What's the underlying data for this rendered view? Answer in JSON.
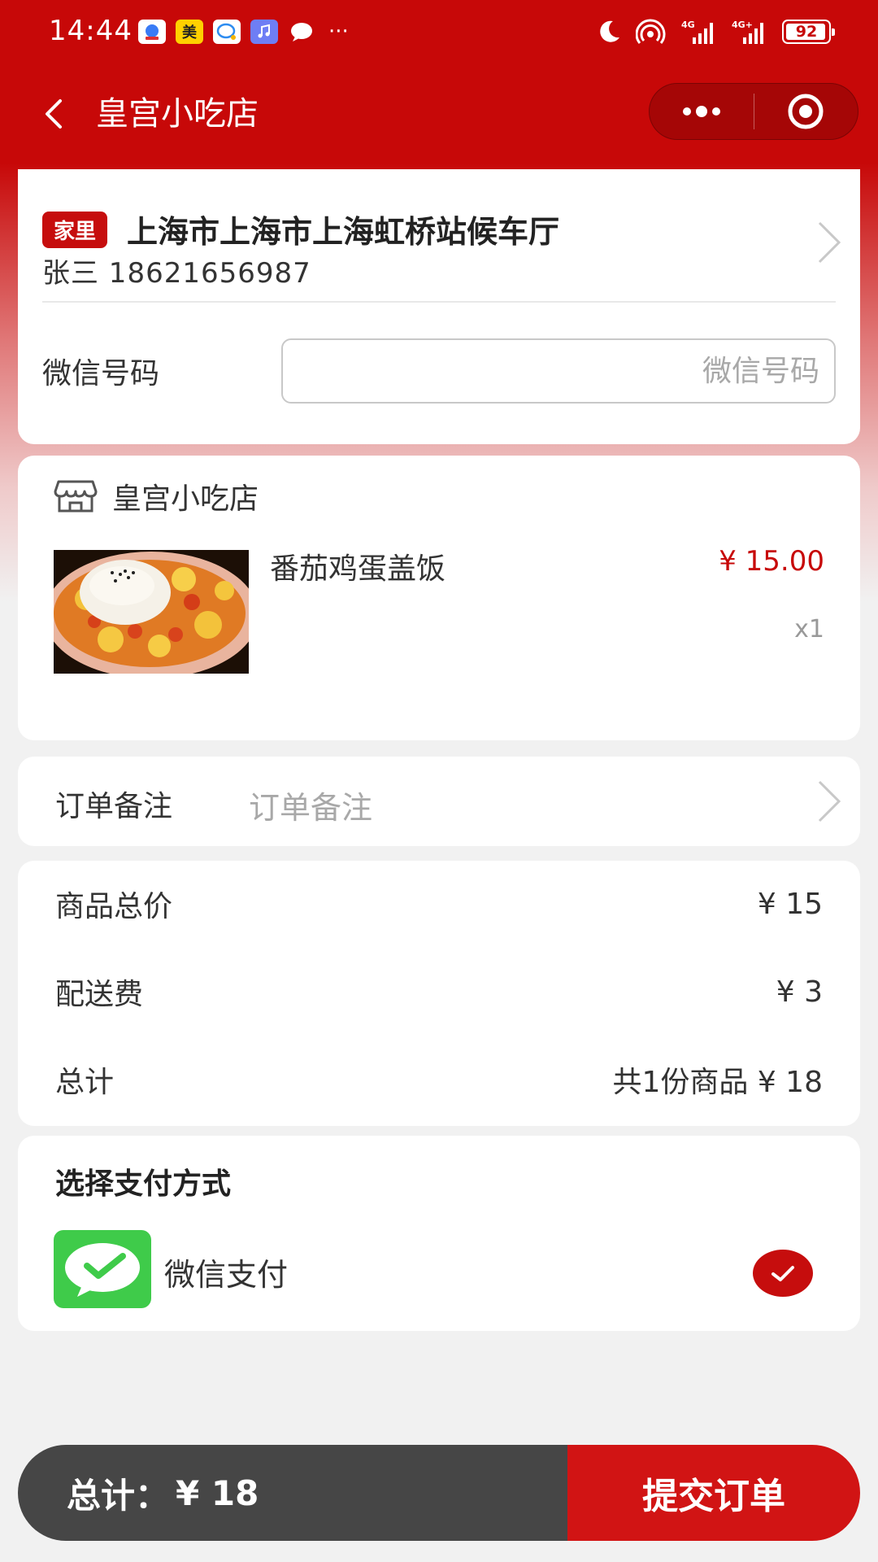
{
  "status_bar": {
    "time": "14:44",
    "apps": [
      "baidu-maps-icon",
      "meituan-icon",
      "wechat-work-icon",
      "music-icon",
      "chat-bubble-icon"
    ],
    "app_labels": [
      "",
      "美",
      "",
      "",
      ""
    ],
    "more": "···",
    "battery": "92"
  },
  "nav": {
    "title": "皇宫小吃店",
    "back_icon": "chevron-left-icon",
    "more_icon": "more-dots-icon",
    "close_icon": "target-close-icon"
  },
  "address": {
    "tag": "家里",
    "text": "上海市上海市上海虹桥站候车厅",
    "contact": "张三 18621656987"
  },
  "wechat_field": {
    "label": "微信号码",
    "placeholder": "微信号码",
    "value": ""
  },
  "shop": {
    "name": "皇宫小吃店",
    "icon": "store-icon",
    "items": [
      {
        "name": "番茄鸡蛋盖饭",
        "price": "¥ 15.00",
        "qty": "x1",
        "image": "tomato-egg-rice-image"
      }
    ]
  },
  "remark": {
    "label": "订单备注",
    "placeholder": "订单备注"
  },
  "price_summary": {
    "goods_label": "商品总价",
    "goods_value": "¥ 15",
    "delivery_label": "配送费",
    "delivery_value": "¥ 3",
    "total_label": "总计",
    "total_value": "共1份商品 ¥ 18"
  },
  "payment": {
    "title": "选择支付方式",
    "method": "微信支付",
    "selected": true
  },
  "bottom_bar": {
    "total_label": "总计：",
    "total_value": "¥ 18",
    "submit_label": "提交订单"
  },
  "colors": {
    "brand_red": "#c70808",
    "submit_red": "#d11414",
    "bar_dark": "#464646",
    "wechat_green": "#3fcb4a"
  }
}
